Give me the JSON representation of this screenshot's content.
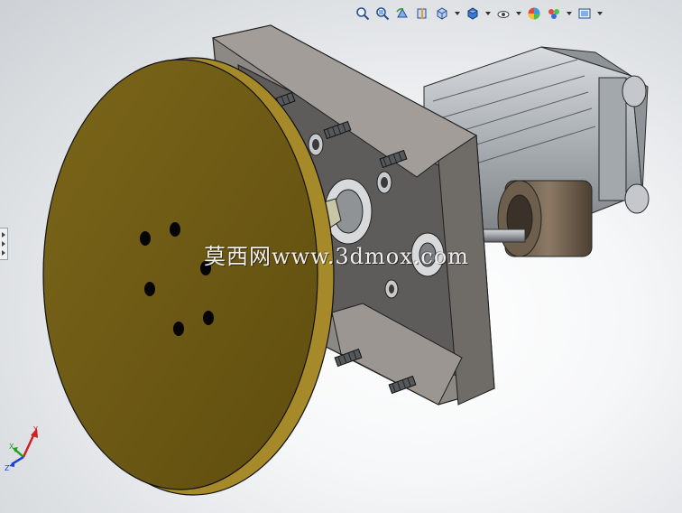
{
  "toolbar": {
    "items": [
      {
        "name": "zoom-to-fit-icon"
      },
      {
        "name": "zoom-to-area-icon"
      },
      {
        "name": "previous-view-icon"
      },
      {
        "name": "section-view-icon"
      },
      {
        "name": "view-orientation-icon",
        "dropdown": true
      },
      {
        "name": "display-style-icon",
        "dropdown": true
      },
      {
        "name": "hide-show-items-icon",
        "dropdown": true
      },
      {
        "name": "edit-appearance-icon"
      },
      {
        "name": "apply-scene-icon",
        "dropdown": true
      },
      {
        "name": "view-settings-icon",
        "dropdown": true
      }
    ]
  },
  "watermark": {
    "text": "莫西网www.3dmox.com"
  },
  "triad": {
    "x_label": "X",
    "y_label": "Y",
    "z_label": "Z"
  },
  "colors": {
    "disk": "#6e5a14",
    "disk_rim": "#a68a2a",
    "plate": "#8f8a86",
    "motor": "#b4b8bc",
    "axis_x": "#d02020",
    "axis_y": "#20a020",
    "axis_z": "#2040d0"
  }
}
